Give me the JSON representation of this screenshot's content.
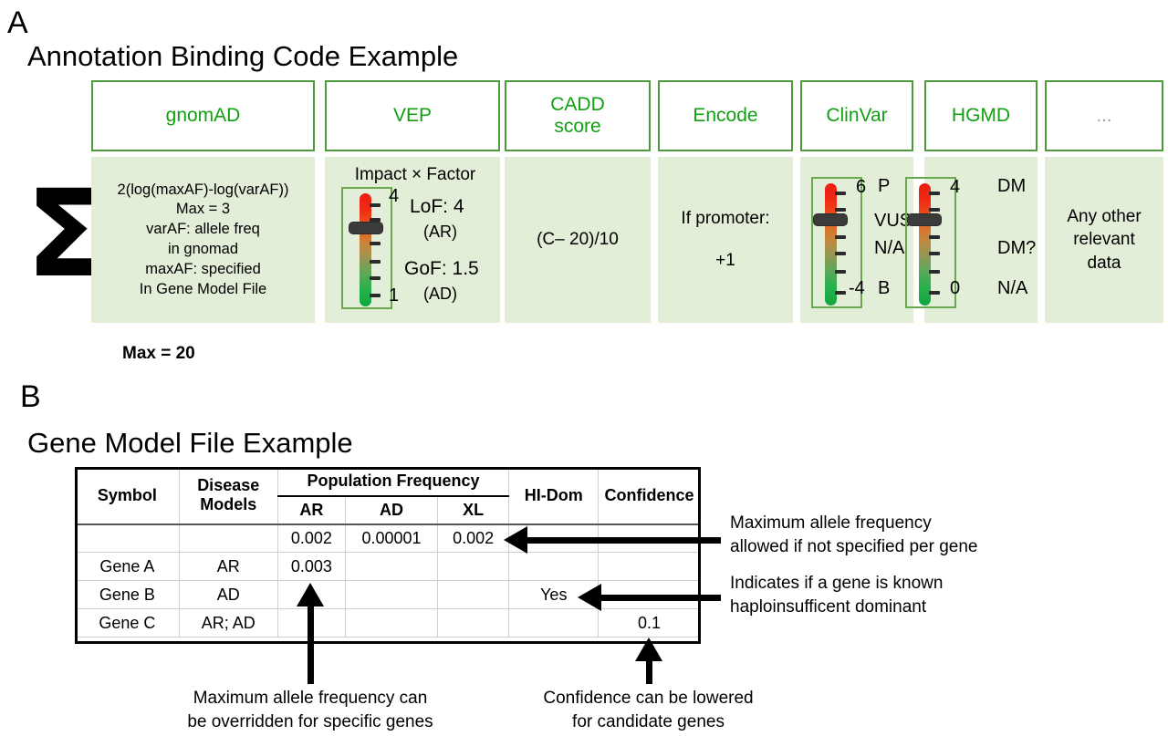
{
  "panelA": {
    "letter": "A",
    "title": "Annotation Binding Code Example",
    "sigma_symbol": "Σ",
    "max_total": "Max = 20",
    "columns": [
      {
        "id": "gnomad",
        "header": "gnomAD",
        "body_lines": [
          "2(log(maxAF)-log(varAF))",
          "Max = 3",
          "varAF: allele freq",
          "in gnomad",
          "maxAF: specified",
          "In Gene Model File"
        ]
      },
      {
        "id": "vep",
        "header": "VEP",
        "caption": "Impact × Factor",
        "thermo": {
          "top_value": "4",
          "bottom_value": "1",
          "slider_pct": 22
        },
        "side_lines": [
          "LoF: 4",
          "(AR)",
          "GoF: 1.5",
          "(AD)"
        ]
      },
      {
        "id": "cadd",
        "header": "CADD\nscore",
        "header_lines": [
          "CADD",
          "score"
        ],
        "body_lines": [
          "(C– 20)/10"
        ]
      },
      {
        "id": "encode",
        "header": "Encode",
        "body_lines": [
          "If promoter:",
          "",
          "+1"
        ]
      },
      {
        "id": "clinvar",
        "header": "ClinVar",
        "thermo": {
          "top_value": "6",
          "bottom_value": "-4",
          "slider_pct": 26
        },
        "side_lines": [
          "P",
          "VUS",
          "N/A",
          "B"
        ]
      },
      {
        "id": "hgmd",
        "header": "HGMD",
        "thermo": {
          "top_value": "4",
          "bottom_value": "0",
          "slider_pct": 26
        },
        "side_lines": [
          "DM",
          "DM?",
          "N/A"
        ]
      },
      {
        "id": "other",
        "header": "...",
        "body_lines": [
          "Any other",
          "relevant",
          "data"
        ]
      }
    ]
  },
  "panelB": {
    "letter": "B",
    "title": "Gene Model File Example",
    "table": {
      "group_header": "Population Frequency",
      "headers": {
        "symbol": "Symbol",
        "disease_models_l1": "Disease",
        "disease_models_l2": "Models",
        "ar": "AR",
        "ad": "AD",
        "xl": "XL",
        "hi_dom": "HI-Dom",
        "confidence": "Confidence"
      },
      "rows": [
        {
          "symbol": "",
          "models": "",
          "ar": "0.002",
          "ad": "0.00001",
          "xl": "0.002",
          "hi_dom": "",
          "confidence": ""
        },
        {
          "symbol": "Gene A",
          "models": "AR",
          "ar": "0.003",
          "ad": "",
          "xl": "",
          "hi_dom": "",
          "confidence": ""
        },
        {
          "symbol": "Gene B",
          "models": "AD",
          "ar": "",
          "ad": "",
          "xl": "",
          "hi_dom": "Yes",
          "confidence": ""
        },
        {
          "symbol": "Gene C",
          "models": "AR; AD",
          "ar": "",
          "ad": "",
          "xl": "",
          "hi_dom": "",
          "confidence": "0.1"
        }
      ]
    },
    "annotations": {
      "default_af": "Maximum allele frequency\nallowed if not specified per gene",
      "hi_dom": "Indicates if a gene is known\nhaploinsufficent dominant",
      "override_af": "Maximum allele frequency can\nbe overridden for specific genes",
      "confidence": "Confidence can be lowered\nfor candidate genes"
    }
  },
  "colors": {
    "green_text": "#11a011",
    "green_border": "#4e9a3e",
    "cell_fill": "#e2eed8",
    "thermo_hot": "#ee1c12",
    "thermo_cold": "#12a83f"
  }
}
